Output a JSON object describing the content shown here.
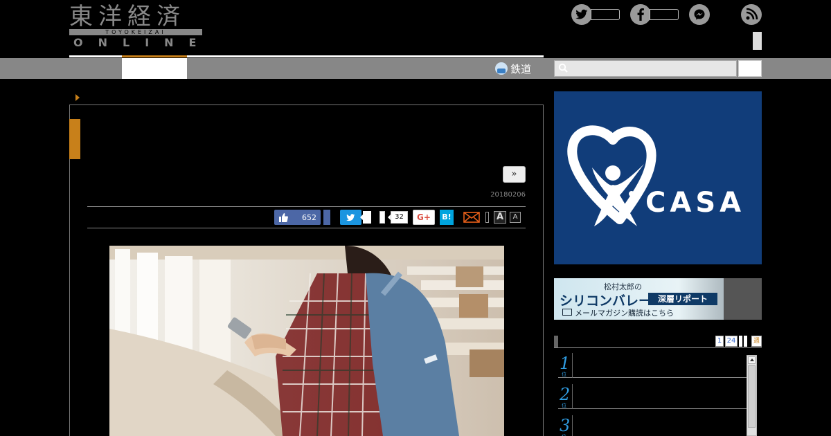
{
  "header": {
    "logo_kanji": "東洋経済",
    "logo_roman": "TOYOKEIZAI",
    "logo_online": "ONLINE"
  },
  "nav": {
    "rail_label": "鉄道"
  },
  "article": {
    "next_label": "»",
    "date": "20180206"
  },
  "share": {
    "fb_like_count": "652",
    "pocket_count": "32",
    "gplus_label": "G+",
    "hatena_label": "B!",
    "font_large": "A",
    "font_small": "A"
  },
  "sidebar": {
    "ad_casa_label": "CASA",
    "banner_line1": "松村太郎の",
    "banner_line2": "シリコンバレー",
    "banner_box": "深層リポート",
    "banner_line3": "メールマガジン購読はこちら",
    "ranking_tabs": [
      "1",
      "24"
    ],
    "ranking_tab_extra": "週",
    "ranking": [
      {
        "num": "1",
        "sub": "位"
      },
      {
        "num": "2",
        "sub": "位"
      },
      {
        "num": "3",
        "sub": "位"
      }
    ]
  },
  "colors": {
    "accent": "#c8801a",
    "nav_gray": "#878787",
    "casa_blue": "#113d7a",
    "facebook": "#4c67a6",
    "twitter": "#1b95e0",
    "hatena": "#00a4de",
    "rank_blue": "#2f9be0"
  }
}
